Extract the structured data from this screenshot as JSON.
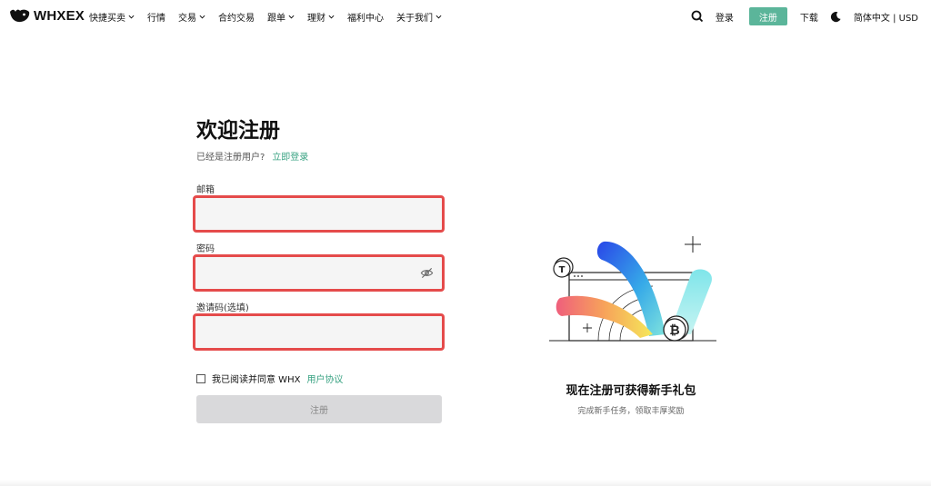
{
  "header": {
    "brand": "WHXEX",
    "nav_items": [
      "快捷买卖",
      "行情",
      "交易",
      "合约交易",
      "跟单",
      "理财",
      "福利中心",
      "关于我们"
    ],
    "login": "登录",
    "signup": "注册",
    "download": "下载",
    "language": "简体中文 | USD",
    "accent_color": "#5bb59a"
  },
  "form": {
    "title": "欢迎注册",
    "existing_user": "已经是注册用户?",
    "login_now": "立即登录",
    "email_label": "邮箱",
    "email_value": "",
    "password_label": "密码",
    "password_value": "",
    "invite_label": "邀请码(选填)",
    "invite_value": "",
    "agree_text": "我已阅读并同意 WHX",
    "agreement_link": "用户协议",
    "submit_label": "注册",
    "error_border_color": "#e54b4b"
  },
  "promo": {
    "title": "现在注册可获得新手礼包",
    "subtitle": "完成新手任务，领取丰厚奖励"
  }
}
